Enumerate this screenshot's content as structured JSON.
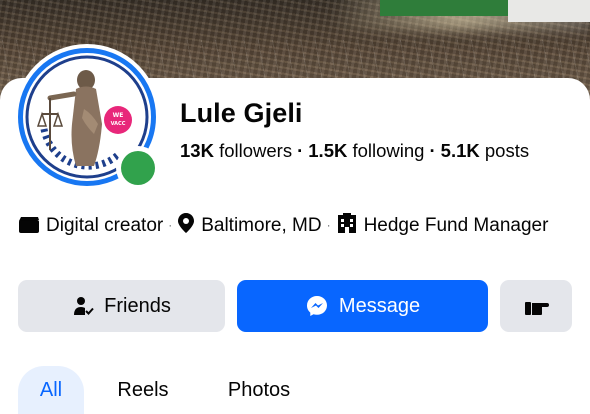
{
  "profile": {
    "name": "Lule Gjeli",
    "followers_count": "13K",
    "followers_label": "followers",
    "following_count": "1.5K",
    "following_label": "following",
    "posts_count": "5.1K",
    "posts_label": "posts",
    "online": true,
    "avatar_badge": "WE VACCINATE",
    "avatar_ring_text": "LET'S GET VACCINATED"
  },
  "details": {
    "category": "Digital creator",
    "location": "Baltimore, MD",
    "work": "Hedge Fund Manager",
    "separator": "·"
  },
  "actions": {
    "friends_label": "Friends",
    "message_label": "Message"
  },
  "tabs": [
    {
      "label": "All",
      "active": true
    },
    {
      "label": "Reels",
      "active": false
    },
    {
      "label": "Photos",
      "active": false
    }
  ],
  "colors": {
    "accent": "#0866ff",
    "avatar_ring": "#1877f2",
    "online": "#31a24c",
    "button_gray": "#e4e6eb",
    "tab_active_bg": "#e7f0fe"
  },
  "icons": {
    "category": "clapperboard-icon",
    "location": "location-pin-icon",
    "work": "building-icon",
    "friends": "person-check-icon",
    "message": "messenger-icon",
    "more": "hand-pointing-icon"
  }
}
